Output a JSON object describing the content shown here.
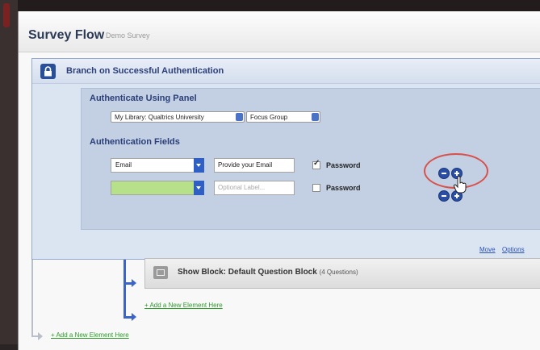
{
  "header": {
    "title": "Survey Flow",
    "subtitle": "Demo Survey"
  },
  "branch": {
    "title": "Branch on Successful Authentication",
    "panel_section": {
      "label": "Authenticate Using Panel",
      "library": "My Library: Qualtrics University",
      "panel": "Focus Group"
    },
    "fields_section": {
      "label": "Authentication Fields",
      "rows": [
        {
          "field": "Email",
          "label_value": "Provide your Email",
          "label_placeholder": "",
          "password_label": "Password",
          "password_checked": true
        },
        {
          "field": "",
          "label_value": "",
          "label_placeholder": "Optional Label...",
          "password_label": "Password",
          "password_checked": false
        }
      ]
    },
    "footer_links": {
      "move": "Move",
      "options": "Options"
    }
  },
  "show_block": {
    "title": "Show Block: Default Question Block",
    "count": "(4 Questions)",
    "add_element": "+ Add a New Element Here"
  },
  "add_element_bottom": "+ Add a New Element Here",
  "icons": [
    "lock-icon",
    "dropdown-arrow-icon",
    "minus-circle-icon",
    "plus-circle-icon",
    "hand-cursor-icon",
    "block-icon",
    "flow-arrow-icon"
  ],
  "colors": {
    "accent_blue": "#2f5fc5",
    "highlight_ring": "#d8514a",
    "link_green": "#2d9a2a",
    "branch_bg": "#dbe4f1"
  }
}
